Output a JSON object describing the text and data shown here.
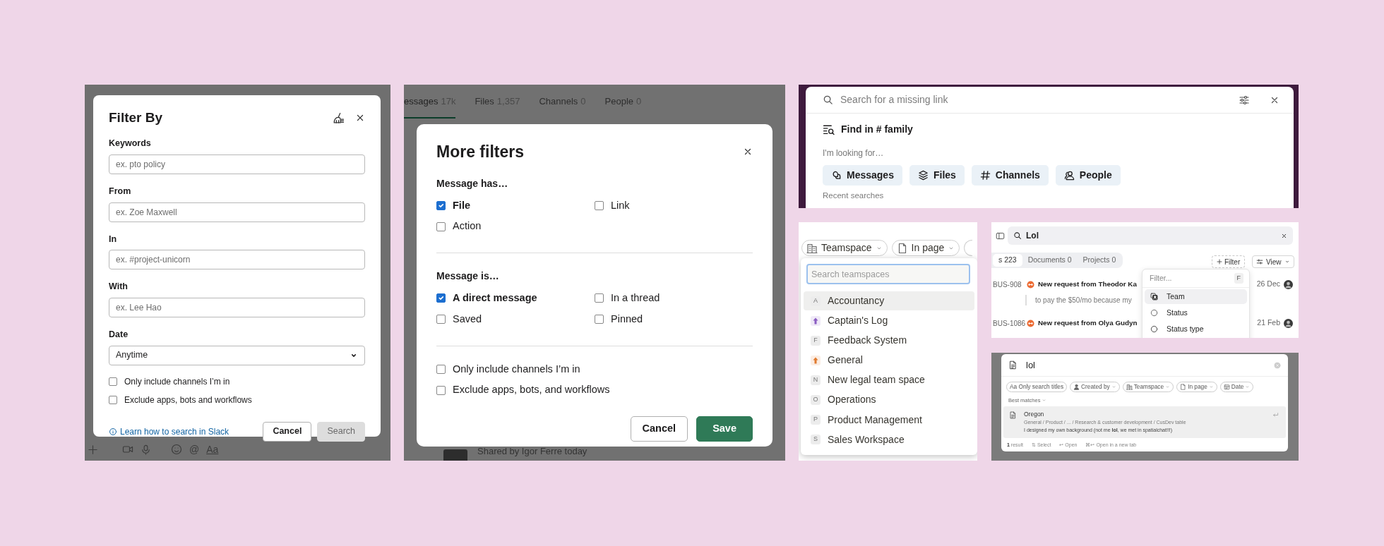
{
  "filter_by": {
    "title": "Filter By",
    "fields": [
      {
        "label": "Keywords",
        "placeholder": "ex. pto policy"
      },
      {
        "label": "From",
        "placeholder": "ex. Zoe Maxwell"
      },
      {
        "label": "In",
        "placeholder": "ex. #project-unicorn"
      },
      {
        "label": "With",
        "placeholder": "ex. Lee Hao"
      }
    ],
    "date": {
      "label": "Date",
      "value": "Anytime"
    },
    "options": [
      {
        "label": "Only include channels I’m in",
        "checked": false
      },
      {
        "label": "Exclude apps, bots and workflows",
        "checked": false
      }
    ],
    "help_link": "Learn how to search in Slack",
    "buttons": [
      {
        "label": "Cancel",
        "kind": "secondary",
        "disabled": false
      },
      {
        "label": "Search",
        "kind": "primary",
        "disabled": true
      }
    ],
    "composer": {
      "mention": "@",
      "format": "Aa"
    }
  },
  "more_filters": {
    "tabs": [
      {
        "label": "essages",
        "count": "17k",
        "selected": true
      },
      {
        "label": "Files",
        "count": "1,357",
        "selected": false
      },
      {
        "label": "Channels",
        "count": "0",
        "selected": false
      },
      {
        "label": "People",
        "count": "0",
        "selected": false
      }
    ],
    "title": "More filters",
    "sections": [
      {
        "heading": "Message has…",
        "options": [
          {
            "label": "File",
            "checked": true
          },
          {
            "label": "Link",
            "checked": false
          },
          {
            "label": "Action",
            "checked": false
          }
        ]
      },
      {
        "heading": "Message is…",
        "options": [
          {
            "label": "A direct message",
            "checked": true
          },
          {
            "label": "In a thread",
            "checked": false
          },
          {
            "label": "Saved",
            "checked": false
          },
          {
            "label": "Pinned",
            "checked": false
          }
        ]
      },
      {
        "options": [
          {
            "label": "Only include channels I’m in",
            "checked": false
          },
          {
            "label": "Exclude apps, bots, and workflows",
            "checked": false
          }
        ]
      }
    ],
    "buttons": [
      {
        "label": "Cancel",
        "kind": "secondary"
      },
      {
        "label": "Save",
        "kind": "primary"
      }
    ],
    "shared_note": "Shared by Igor Ferre today"
  },
  "search_bar": {
    "placeholder": "Search for a missing link",
    "scope_label": "Find in",
    "scope_channel": "# family",
    "hint": "I'm looking for…",
    "chips": [
      {
        "kind": "messages",
        "label": "Messages"
      },
      {
        "kind": "files",
        "label": "Files"
      },
      {
        "kind": "channels",
        "label": "Channels"
      },
      {
        "kind": "people",
        "label": "People"
      }
    ],
    "recent_label": "Recent searches"
  },
  "teamspace_menu": {
    "chips": [
      {
        "kind": "teamspace",
        "label": "Teamspace"
      },
      {
        "kind": "page",
        "label": "In page"
      }
    ],
    "placeholder": "Search teamspaces",
    "items": [
      {
        "kind": "letter",
        "letter": "A",
        "label": "Accountancy",
        "selected": true
      },
      {
        "kind": "icon",
        "color": "#8a5cc2",
        "label": "Captain's Log",
        "selected": false
      },
      {
        "kind": "letter",
        "letter": "F",
        "label": "Feedback System",
        "selected": false
      },
      {
        "kind": "icon",
        "color": "#e07a2e",
        "label": "General",
        "selected": false
      },
      {
        "kind": "letter",
        "letter": "N",
        "label": "New legal team space",
        "selected": false
      },
      {
        "kind": "letter",
        "letter": "O",
        "label": "Operations",
        "selected": false
      },
      {
        "kind": "letter",
        "letter": "P",
        "label": "Product Management",
        "selected": false
      },
      {
        "kind": "letter",
        "letter": "S",
        "label": "Sales Workspace",
        "selected": false
      }
    ]
  },
  "issues_search": {
    "query": "Lol",
    "tabs": [
      {
        "label": "s",
        "count": "223",
        "selected": true
      },
      {
        "label": "Documents",
        "count": "0",
        "selected": false
      },
      {
        "label": "Projects",
        "count": "0",
        "selected": false
      }
    ],
    "filter_button": "Filter",
    "view_button": "View",
    "rows": [
      {
        "id": "BUS-908",
        "title": "New request from Theodor Ka",
        "date": "26 Dec",
        "snippet": "to pay the $50/mo because my"
      },
      {
        "id": "BUS-1086",
        "title": "New request from Olya Gudyn",
        "date": "21 Feb"
      }
    ],
    "filter_menu": {
      "placeholder": "Filter...",
      "shortcut": "F",
      "items": [
        {
          "kind": "team",
          "label": "Team",
          "selected": true
        },
        {
          "kind": "status",
          "label": "Status",
          "selected": false
        },
        {
          "kind": "status_type",
          "label": "Status type",
          "selected": false
        }
      ]
    }
  },
  "page_search": {
    "query": "lol",
    "filters": [
      {
        "kind": "titles",
        "prefix": "Aa",
        "label": "Only search titles",
        "has_menu": false
      },
      {
        "kind": "person",
        "label": "Created by",
        "has_menu": true
      },
      {
        "kind": "teamspace",
        "label": "Teamspace",
        "has_menu": true
      },
      {
        "kind": "page",
        "label": "In page",
        "has_menu": true
      },
      {
        "kind": "date",
        "label": "Date",
        "has_menu": true
      }
    ],
    "section": "Best matches",
    "results": [
      {
        "title": "Oregon",
        "path": "General / Product / ... / Research & customer development / CusDev table",
        "snippet": "I designed my own background (not me **lol**, we met in spatialchat!!!)",
        "selected": true
      }
    ],
    "footer": [
      {
        "label": "**1** result"
      },
      {
        "keys": "⇅",
        "label": "Select"
      },
      {
        "keys": "↩",
        "label": "Open"
      },
      {
        "keys": "⌘↩",
        "label": "Open in a new tab"
      }
    ]
  }
}
